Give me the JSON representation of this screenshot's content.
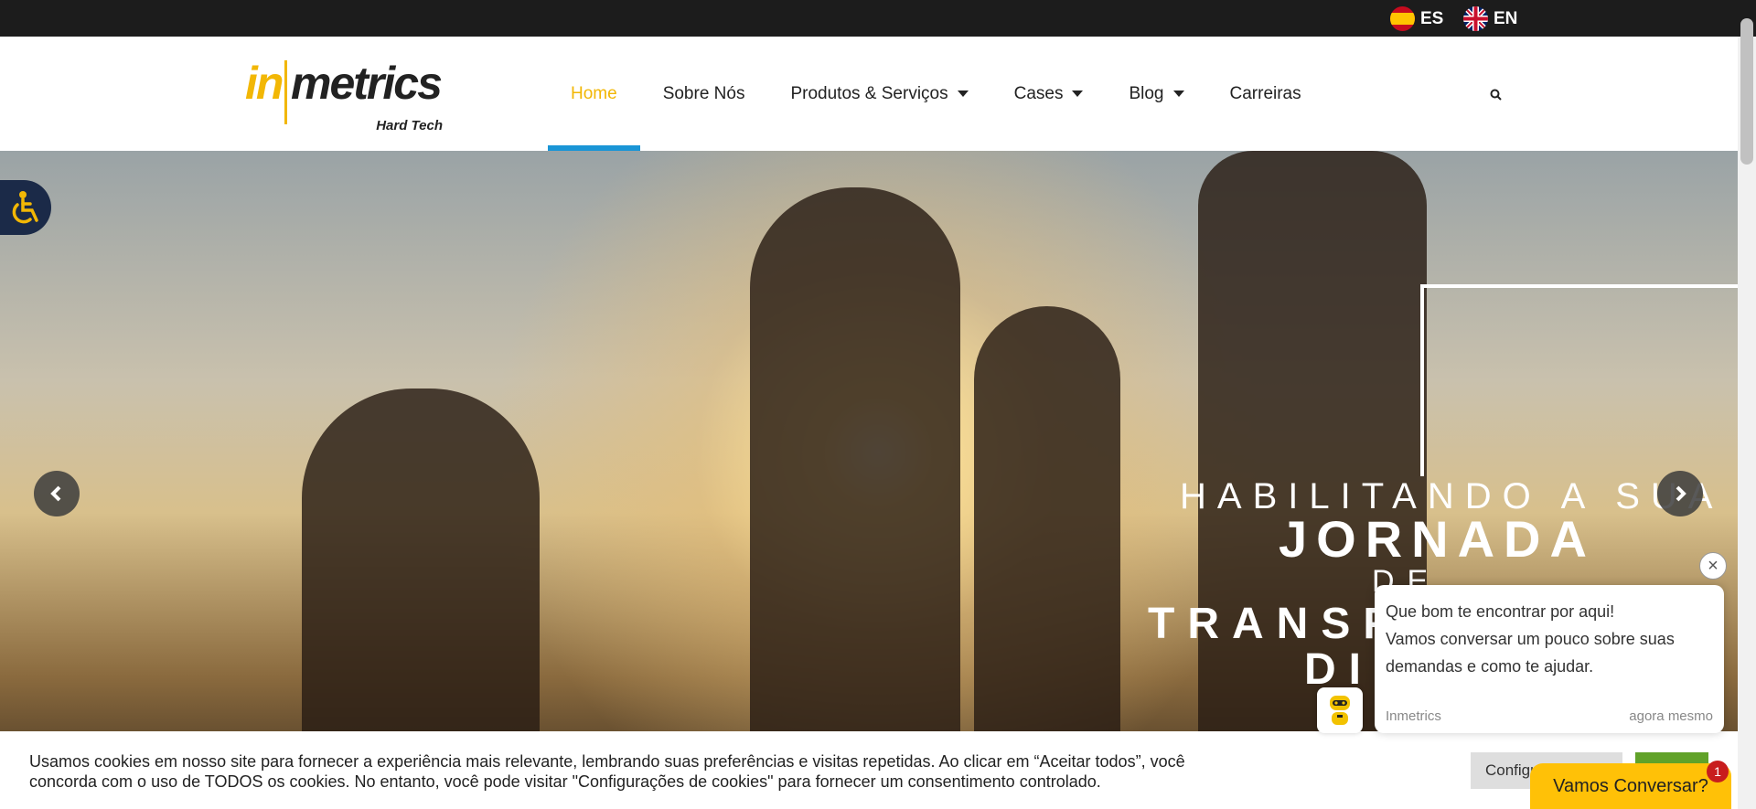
{
  "topbar": {
    "languages": [
      {
        "code": "ES",
        "flag": "flag-spain-icon"
      },
      {
        "code": "EN",
        "flag": "flag-uk-icon"
      }
    ]
  },
  "header": {
    "logo": {
      "word1": "in",
      "word2": "metrics",
      "tagline": "Hard Tech"
    },
    "nav": [
      {
        "label": "Home",
        "active": true
      },
      {
        "label": "Sobre Nós"
      },
      {
        "label": "Produtos & Serviços",
        "dropdown": true
      },
      {
        "label": "Cases",
        "dropdown": true
      },
      {
        "label": "Blog",
        "dropdown": true
      },
      {
        "label": "Carreiras"
      }
    ]
  },
  "hero": {
    "line1": "HABILITANDO A SUA",
    "line2": "JORNADA",
    "line3": "DE",
    "line4": "TRANSF",
    "line5": "DI"
  },
  "chat": {
    "message_line1": "Que bom te encontrar por aqui!",
    "message_line2": "Vamos conversar um pouco sobre suas",
    "message_line3": "demandas e como te ajudar.",
    "sender": "Inmetrics",
    "time": "agora mesmo",
    "button_label": "Vamos Conversar?",
    "badge_count": "1",
    "close_glyph": "×"
  },
  "cookie": {
    "text_line1": "Usamos cookies em nosso site para fornecer a experiência mais relevante, lembrando suas preferências e visitas repetidas. Ao clicar em “Aceitar todos”, você",
    "text_line2": "concorda com o uso de TODOS os cookies. No entanto, você pode visitar \"Configurações de cookies\" para fornecer um consentimento controlado.",
    "config_label": "Configu"
  },
  "colors": {
    "brand_yellow": "#f2b705",
    "active_underline": "#1a95d6",
    "topbar": "#1c1c1c",
    "chat_button": "#ffc107",
    "accept_green": "#61a229"
  }
}
